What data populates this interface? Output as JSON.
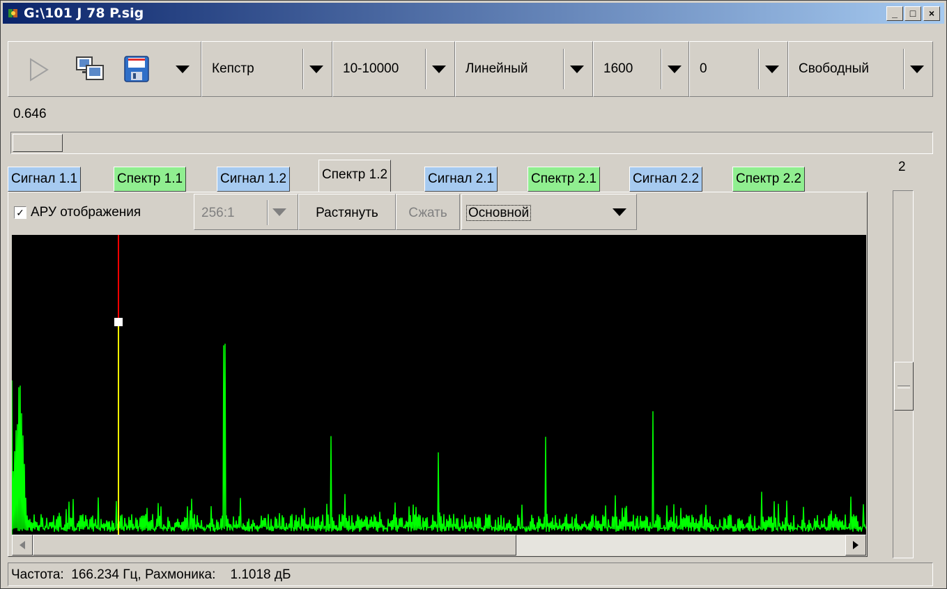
{
  "window": {
    "title": "G:\\101 J 78 P.sig",
    "buttons": {
      "minimize": "_",
      "maximize": "□",
      "close": "×"
    }
  },
  "toolbar": {
    "icons": [
      "play-icon",
      "monitors-icon",
      "save-icon",
      "chevron-down-icon"
    ],
    "combos": [
      {
        "label": "Кепстр"
      },
      {
        "label": "10-10000"
      },
      {
        "label": "Линейный"
      },
      {
        "label": "1600"
      },
      {
        "label": "0"
      },
      {
        "label": "Свободный"
      }
    ]
  },
  "position_value": "0.646",
  "position_fraction": 0.0,
  "tabs": [
    {
      "label": "Сигнал 1.1",
      "color": "#a6caf0"
    },
    {
      "label": "Спектр 1.1",
      "color": "#90ee90"
    },
    {
      "label": "Сигнал 1.2",
      "color": "#a6caf0"
    },
    {
      "label": "Спектр 1.2",
      "color": "#90ee90",
      "active": true
    },
    {
      "label": "Сигнал 2.1",
      "color": "#a6caf0"
    },
    {
      "label": "Спектр 2.1",
      "color": "#90ee90"
    },
    {
      "label": "Сигнал 2.2",
      "color": "#a6caf0"
    },
    {
      "label": "Спектр 2.2",
      "color": "#90ee90"
    }
  ],
  "subtoolbar": {
    "agc_checked": true,
    "agc_label": "АРУ отображения",
    "ratio": "256:1",
    "stretch": "Растянуть",
    "compress": "Сжать",
    "mode": "Основной"
  },
  "vertical_label": "2",
  "colors": {
    "spectrum": "#00ff00",
    "cursor_top": "#ff0000",
    "cursor_bottom": "#ffff00",
    "background": "#000000"
  },
  "status": {
    "frequency_label": "Частота:",
    "frequency_value": "166.234 Гц",
    "harmonic_label": "Рахмоника:",
    "harmonic_value": "1.1018 дБ"
  }
}
